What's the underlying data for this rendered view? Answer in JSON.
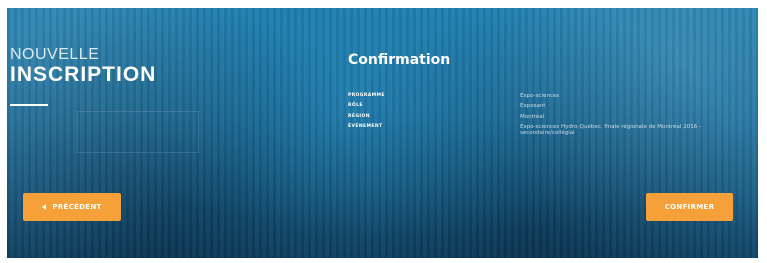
{
  "hero": {
    "title_line1": "NOUVELLE",
    "title_line2": "INSCRIPTION"
  },
  "confirmation": {
    "heading": "Confirmation",
    "fields": [
      {
        "label": "PROGRAMME",
        "value": "Expo-sciences"
      },
      {
        "label": "RÔLE",
        "value": "Exposant"
      },
      {
        "label": "RÉGION",
        "value": "Montréal"
      },
      {
        "label": "ÉVÉNEMENT",
        "value": "Expo-sciences Hydro-Québec, finale régionale de Montréal 2016 - secondaire/collégial"
      }
    ]
  },
  "nav": {
    "previous_label": "PRÉCÉDENT",
    "confirm_label": "CONFIRMER"
  },
  "colors": {
    "panel_bg": "#1a6e9c",
    "button_accent": "#f5a038",
    "text_white": "#ffffff"
  }
}
